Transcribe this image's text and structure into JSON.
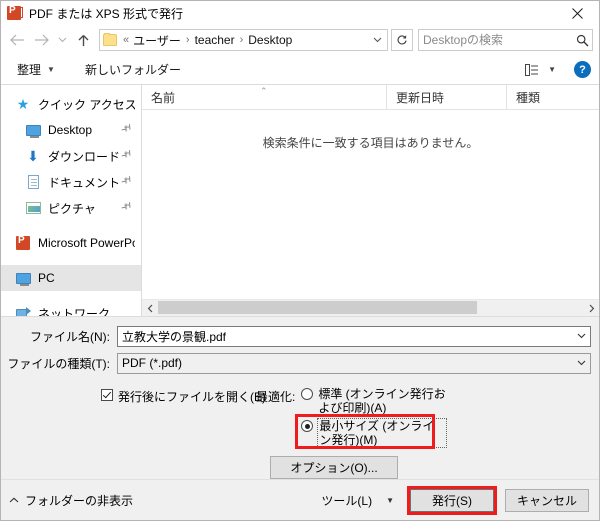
{
  "window": {
    "title": "PDF または XPS 形式で発行",
    "app_icon": "powerpoint-pdf-icon",
    "close_label": "✕"
  },
  "nav": {
    "back_icon": "arrow-left-icon",
    "forward_icon": "arrow-right-icon",
    "recent_icon": "chevron-down-icon",
    "up_icon": "arrow-up-icon",
    "folder_icon": "folder-icon",
    "breadcrumb": {
      "prefix": "«",
      "items": [
        "ユーザー",
        "teacher",
        "Desktop"
      ],
      "separator": "›"
    },
    "address_dropdown_icon": "chevron-down-icon",
    "refresh_icon": "refresh-icon",
    "refresh_glyph": "↻"
  },
  "search": {
    "placeholder": "Desktopの検索",
    "value": "",
    "icon": "search-icon"
  },
  "commandbar": {
    "organize_label": "整理",
    "organize_caret": "▼",
    "new_folder_label": "新しいフォルダー",
    "view_icon": "list-view-icon",
    "view_caret": "▼",
    "help_icon": "help-icon",
    "help_glyph": "?"
  },
  "sidebar": {
    "items": [
      {
        "label": "クイック アクセス",
        "icon": "star-icon",
        "pinned": false,
        "indent": false,
        "selected": false
      },
      {
        "label": "Desktop",
        "icon": "desktop-monitor-icon",
        "pinned": true,
        "indent": true,
        "selected": false
      },
      {
        "label": "ダウンロード",
        "icon": "download-arrow-icon",
        "pinned": true,
        "indent": true,
        "selected": false
      },
      {
        "label": "ドキュメント",
        "icon": "document-icon",
        "pinned": true,
        "indent": true,
        "selected": false
      },
      {
        "label": "ピクチャ",
        "icon": "picture-icon",
        "pinned": true,
        "indent": true,
        "selected": false
      },
      {
        "label": "Microsoft PowerPoin",
        "icon": "powerpoint-icon",
        "pinned": false,
        "indent": false,
        "selected": false
      },
      {
        "label": "PC",
        "icon": "pc-monitor-icon",
        "pinned": false,
        "indent": false,
        "selected": true
      },
      {
        "label": "ネットワーク",
        "icon": "network-icon",
        "pinned": false,
        "indent": false,
        "selected": false
      }
    ],
    "pin_glyph": "📌"
  },
  "filelist": {
    "columns": [
      {
        "label": "名前",
        "sorted": true,
        "sort_caret": "⌃"
      },
      {
        "label": "更新日時",
        "sorted": false,
        "sort_caret": ""
      },
      {
        "label": "種類",
        "sorted": false,
        "sort_caret": ""
      }
    ],
    "rows": [],
    "empty_message": "検索条件に一致する項目はありません。",
    "scroll_left_icon": "chevron-left-icon",
    "scroll_right_icon": "chevron-right-icon"
  },
  "form": {
    "filename_label": "ファイル名(N):",
    "filename_value": "立教大学の景観.pdf",
    "filetype_label": "ファイルの種類(T):",
    "filetype_value": "PDF (*.pdf)",
    "dropdown_icon": "chevron-down-icon",
    "open_after_publish": {
      "label": "発行後にファイルを開く(E)",
      "checked": true
    },
    "optimize_label": "最適化:",
    "optimize_options": [
      {
        "label": "標準 (オンライン発行および印刷)(A)",
        "selected": false,
        "highlighted": false
      },
      {
        "label": "最小サイズ (オンライン発行)(M)",
        "selected": true,
        "highlighted": true
      }
    ],
    "options_button": "オプション(O)..."
  },
  "footer": {
    "hide_folders_label": "フォルダーの非表示",
    "hide_folders_caret": "⌃",
    "tools_label": "ツール(L)",
    "tools_caret": "▼",
    "publish_label": "発行(S)",
    "publish_highlighted": true,
    "cancel_label": "キャンセル"
  },
  "colors": {
    "highlight": "#ee1c1c",
    "accent": "#0a6ebd",
    "powerpoint": "#d24726",
    "form_background": "#f0f0f0"
  }
}
